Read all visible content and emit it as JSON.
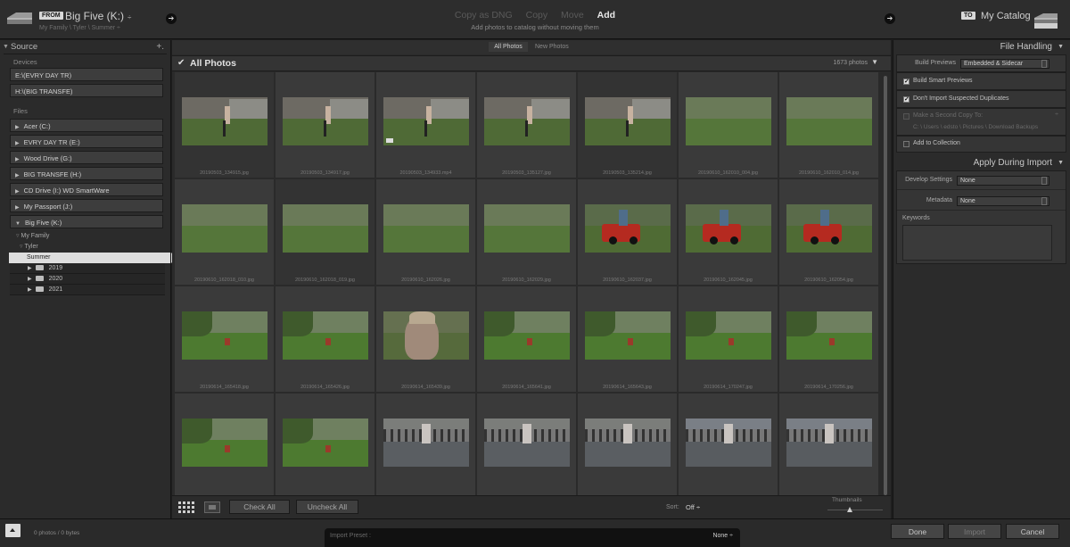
{
  "header": {
    "from_tag": "FROM",
    "source_name": "Big Five (K:)",
    "source_caret": "÷",
    "source_path": "My Family \\ Tyler \\ Summer ÷",
    "modes": [
      "Copy as DNG",
      "Copy",
      "Move",
      "Add"
    ],
    "active_mode": "Add",
    "mode_description": "Add photos to catalog without moving them",
    "to_tag": "TO",
    "destination_name": "My Catalog"
  },
  "source_panel": {
    "title": "Source",
    "devices_label": "Devices",
    "devices": [
      "E:\\(EVRY DAY TR)",
      "H:\\(BIG TRANSFE)"
    ],
    "files_label": "Files",
    "drives": [
      {
        "label": "Acer (C:)",
        "expanded": false
      },
      {
        "label": "EVRY DAY TR (E:)",
        "expanded": false
      },
      {
        "label": "Wood Drive (G:)",
        "expanded": false
      },
      {
        "label": "BIG TRANSFE (H:)",
        "expanded": false
      },
      {
        "label": "CD Drive (I:) WD SmartWare",
        "expanded": false
      },
      {
        "label": "My Passport (J:)",
        "expanded": false
      },
      {
        "label": "Big Five (K:)",
        "expanded": true
      }
    ],
    "tree": [
      "My Family",
      "Tyler",
      "Summer"
    ],
    "subfolders": [
      "2019",
      "2020",
      "2021"
    ]
  },
  "center": {
    "tabs": [
      "All Photos",
      "New Photos"
    ],
    "active_tab": "All Photos",
    "section_title": "All Photos",
    "photo_count": "1673 photos",
    "photos": [
      {
        "name": "20190503_134915.jpg",
        "scene": "yard"
      },
      {
        "name": "20190503_134917.jpg",
        "scene": "yard"
      },
      {
        "name": "20190503_134933.mp4",
        "scene": "yard",
        "video": true
      },
      {
        "name": "20190503_135127.jpg",
        "scene": "yard"
      },
      {
        "name": "20190503_135214.jpg",
        "scene": "yard"
      },
      {
        "name": "20190610_162010_004.jpg",
        "scene": "grass"
      },
      {
        "name": "20190610_162010_014.jpg",
        "scene": "grass"
      },
      {
        "name": "20190610_162018_010.jpg",
        "scene": "grass"
      },
      {
        "name": "20190610_162018_019.jpg",
        "scene": "grass"
      },
      {
        "name": "20190610_162026.jpg",
        "scene": "grass"
      },
      {
        "name": "20190610_162029.jpg",
        "scene": "grass"
      },
      {
        "name": "20190610_162037.jpg",
        "scene": "jeep"
      },
      {
        "name": "20190610_162045.jpg",
        "scene": "jeep"
      },
      {
        "name": "20190610_162054.jpg",
        "scene": "jeep"
      },
      {
        "name": "20190614_165418.jpg",
        "scene": "lawn"
      },
      {
        "name": "20190614_165426.jpg",
        "scene": "lawn"
      },
      {
        "name": "20190614_165439.jpg",
        "scene": "face"
      },
      {
        "name": "20190614_165641.jpg",
        "scene": "lawn"
      },
      {
        "name": "20190614_165643.jpg",
        "scene": "lawn"
      },
      {
        "name": "20190614_170247.jpg",
        "scene": "lawn"
      },
      {
        "name": "20190614_170256.jpg",
        "scene": "lawn"
      },
      {
        "name": "",
        "scene": "lawn"
      },
      {
        "name": "",
        "scene": "lawn"
      },
      {
        "name": "",
        "scene": "patio"
      },
      {
        "name": "",
        "scene": "patio"
      },
      {
        "name": "",
        "scene": "patio"
      },
      {
        "name": "",
        "scene": "fence"
      },
      {
        "name": "",
        "scene": "fence"
      }
    ],
    "check_all_label": "Check All",
    "uncheck_all_label": "Uncheck All",
    "sort_label": "Sort:",
    "sort_value": "Off ÷",
    "thumbnails_label": "Thumbnails"
  },
  "file_handling": {
    "title": "File Handling",
    "build_previews_label": "Build Previews",
    "build_previews_value": "Embedded & Sidecar",
    "smart_previews_label": "Build Smart Previews",
    "no_duplicates_label": "Don't Import Suspected Duplicates",
    "second_copy_label": "Make a Second Copy To:",
    "second_copy_path": "C: \\ Users \\ edsto \\ Pictures \\ Download Backups",
    "add_collection_label": "Add to Collection"
  },
  "apply_during_import": {
    "title": "Apply During Import",
    "develop_label": "Develop Settings",
    "develop_value": "None",
    "metadata_label": "Metadata",
    "metadata_value": "None",
    "keywords_label": "Keywords"
  },
  "footer": {
    "status": "0 photos / 0 bytes",
    "preset_label": "Import Preset :",
    "preset_value": "None ÷",
    "done_label": "Done",
    "import_label": "Import",
    "cancel_label": "Cancel"
  },
  "colors": {
    "background": "#1e1e1e",
    "panel": "#2b2b2b",
    "selected_tree": "#dedede",
    "jeep_red": "#b52a20",
    "grass": "#5a7a3a"
  }
}
